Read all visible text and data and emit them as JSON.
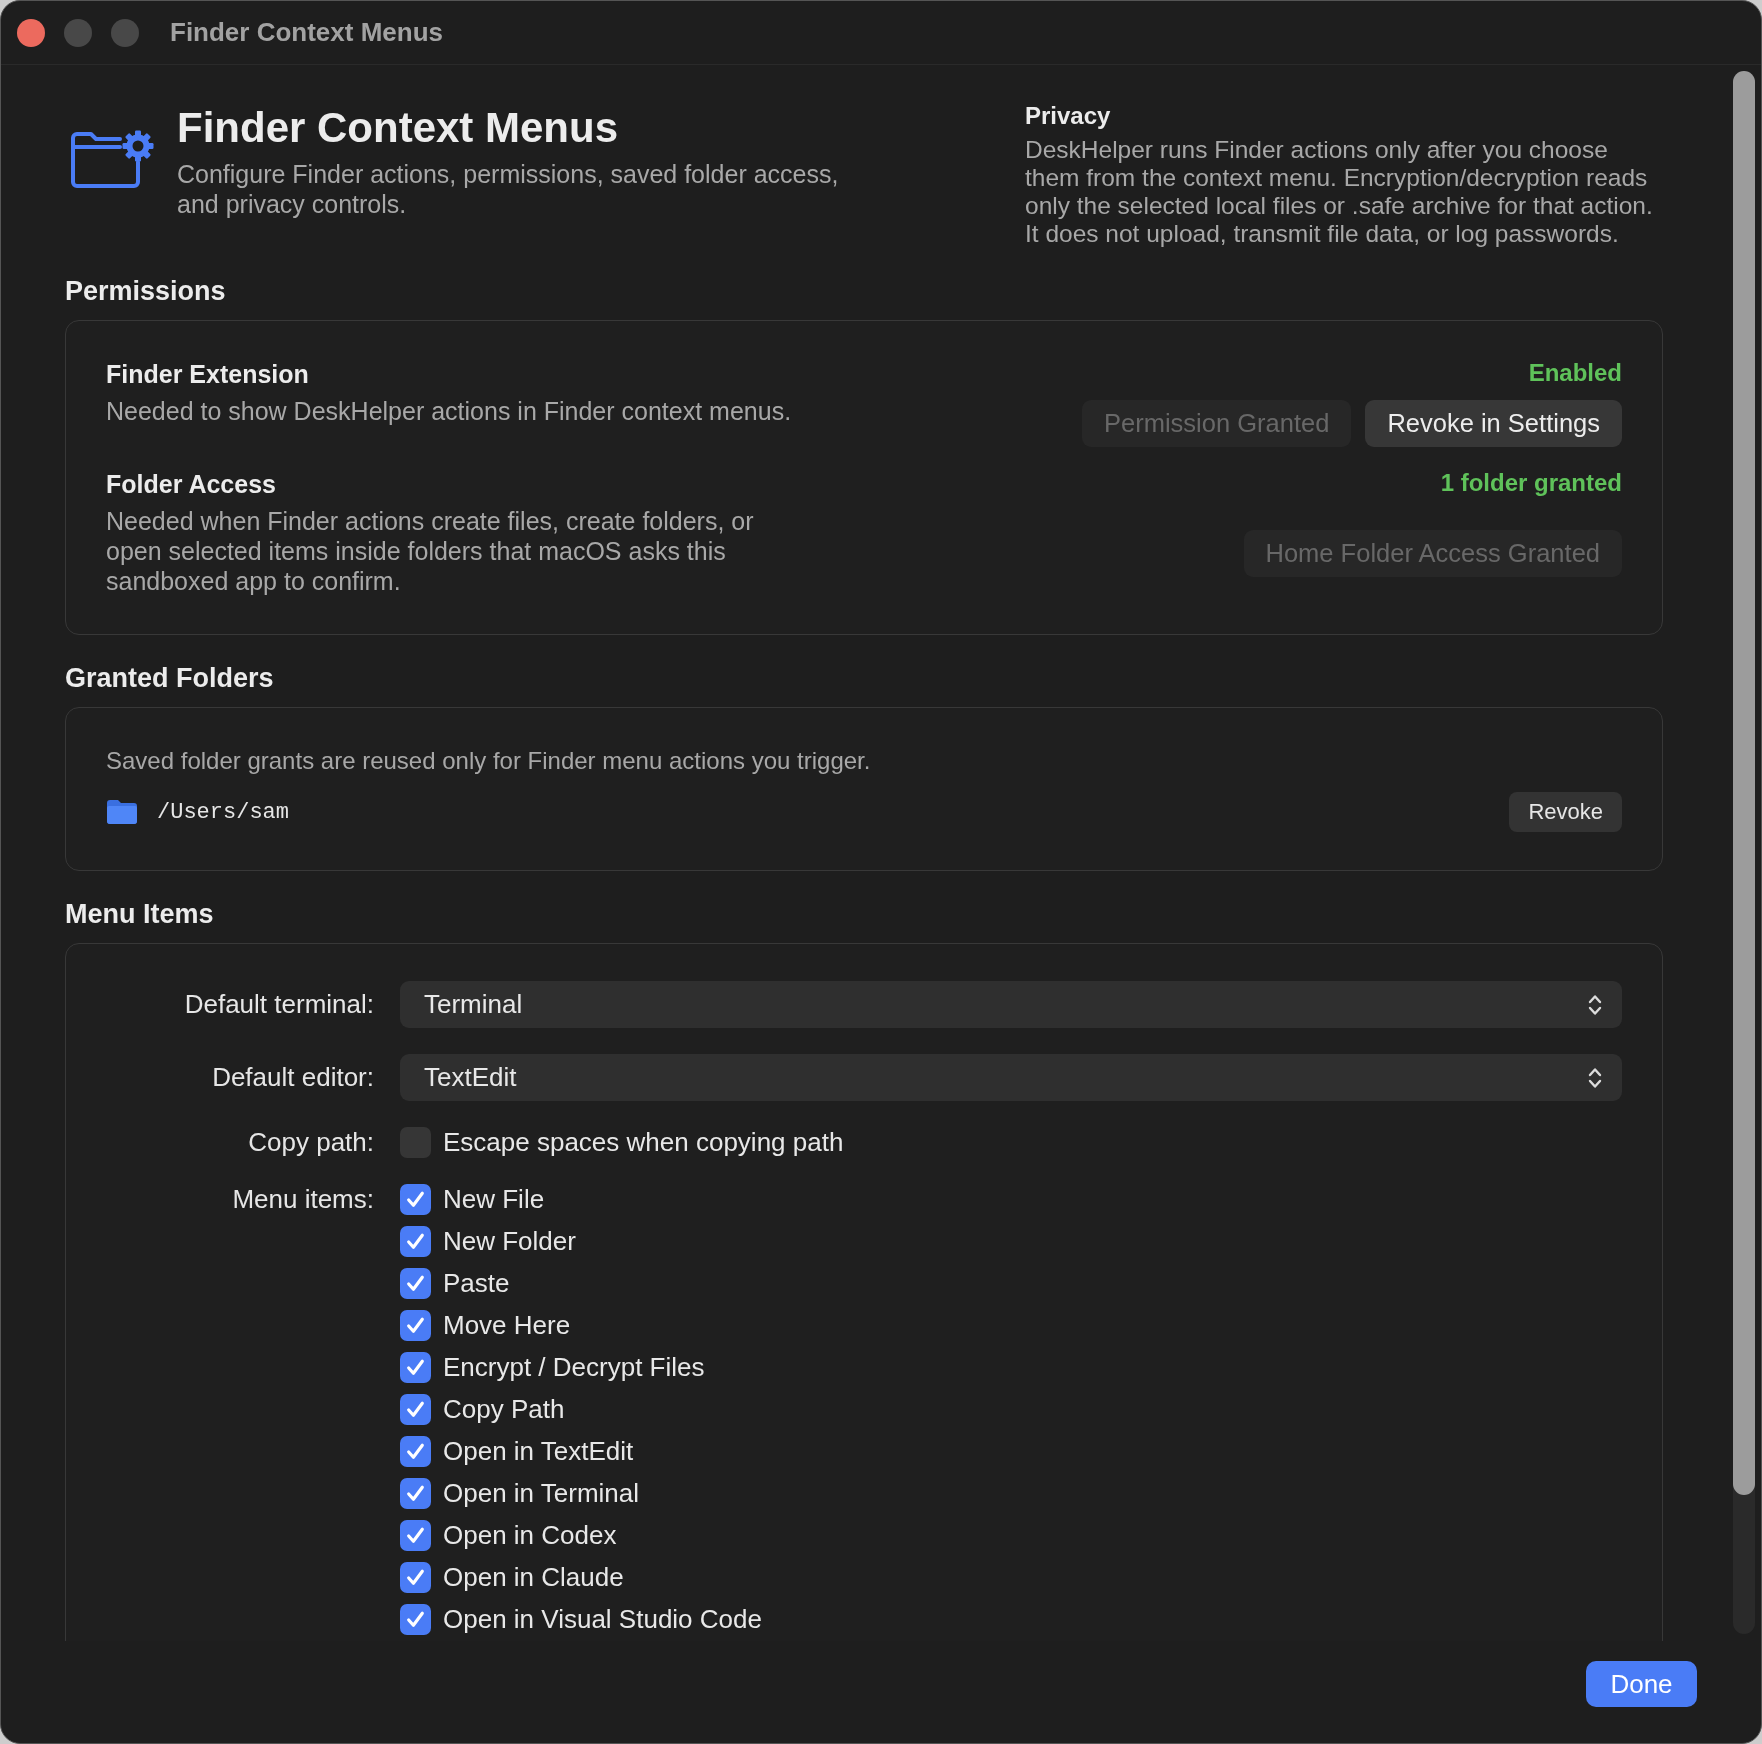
{
  "window": {
    "title": "Finder Context Menus",
    "controls": [
      {
        "kind": "close",
        "disabled": false
      },
      {
        "kind": "minimize",
        "disabled": true
      },
      {
        "kind": "zoom",
        "disabled": true
      }
    ]
  },
  "header": {
    "title": "Finder Context Menus",
    "subtitle": "Configure Finder actions, permissions, saved folder access, and privacy controls."
  },
  "privacy": {
    "heading": "Privacy",
    "text": "DeskHelper runs Finder actions only after you choose them from the context menu. Encryption/decryption reads only the selected local files or .safe archive for that action. It does not upload, transmit file data, or log passwords."
  },
  "permissions": {
    "heading": "Permissions",
    "items": [
      {
        "title": "Finder Extension",
        "description": "Needed to show DeskHelper actions in Finder context menus.",
        "status": "Enabled",
        "buttons": [
          {
            "label": "Permission Granted",
            "disabled": true
          },
          {
            "label": "Revoke in Settings",
            "disabled": false
          }
        ]
      },
      {
        "title": "Folder Access",
        "description": "Needed when Finder actions create files, create folders, or open selected items inside folders that macOS asks this sandboxed app to confirm.",
        "status": "1 folder granted",
        "buttons": [
          {
            "label": "Home Folder Access Granted",
            "disabled": true
          }
        ]
      }
    ]
  },
  "granted_folders": {
    "heading": "Granted Folders",
    "note": "Saved folder grants are reused only for Finder menu actions you trigger.",
    "folders": [
      {
        "path": "/Users/sam",
        "action": "Revoke"
      }
    ]
  },
  "menu_items": {
    "heading": "Menu Items",
    "rows": [
      {
        "kind": "dropdown",
        "label": "Default terminal:",
        "value": "Terminal"
      },
      {
        "kind": "dropdown",
        "label": "Default editor:",
        "value": "TextEdit"
      },
      {
        "kind": "checkbox",
        "label": "Copy path:",
        "options": [
          {
            "label": "Escape spaces when copying path",
            "checked": false
          }
        ]
      },
      {
        "kind": "checkbox",
        "label": "Menu items:",
        "options": [
          {
            "label": "New File",
            "checked": true
          },
          {
            "label": "New Folder",
            "checked": true
          },
          {
            "label": "Paste",
            "checked": true
          },
          {
            "label": "Move Here",
            "checked": true
          },
          {
            "label": "Encrypt / Decrypt Files",
            "checked": true
          },
          {
            "label": "Copy Path",
            "checked": true
          },
          {
            "label": "Open in TextEdit",
            "checked": true
          },
          {
            "label": "Open in Terminal",
            "checked": true
          },
          {
            "label": "Open in Codex",
            "checked": true
          },
          {
            "label": "Open in Claude",
            "checked": true
          },
          {
            "label": "Open in Visual Studio Code",
            "checked": true
          }
        ]
      }
    ]
  },
  "footer": {
    "done": "Done"
  }
}
